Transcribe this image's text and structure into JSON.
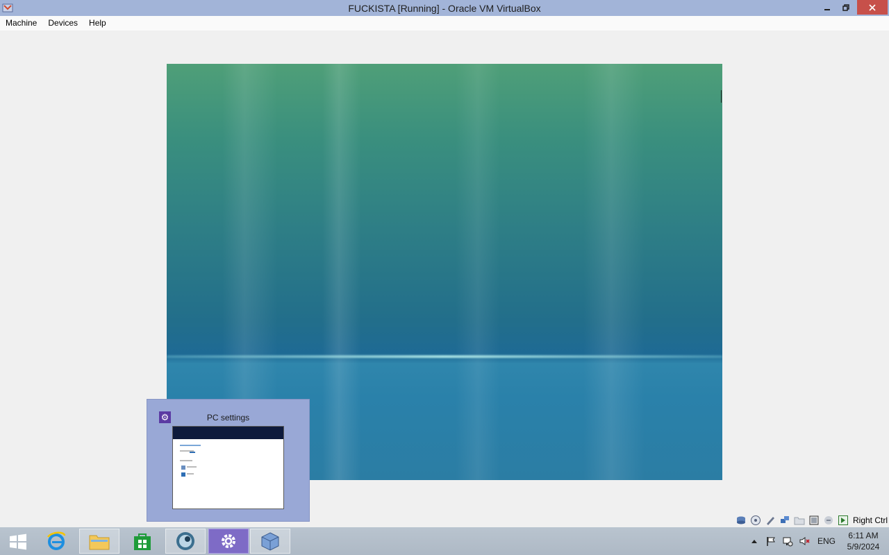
{
  "window": {
    "title": "FUCKISTA [Running] - Oracle VM VirtualBox",
    "icon": "virtualbox-icon",
    "controls": {
      "minimize": "minimize-icon",
      "restore": "restore-icon",
      "close": "close-icon"
    }
  },
  "menu": {
    "items": [
      {
        "label": "Machine"
      },
      {
        "label": "Devices"
      },
      {
        "label": "Help"
      }
    ]
  },
  "guest": {
    "wallpaper": "windows-vista-aurora",
    "colors": {
      "top": "#4f9f78",
      "bottom": "#2b7da4"
    }
  },
  "preview": {
    "title": "PC settings",
    "icon": "gear-icon"
  },
  "statusbar": {
    "icons": [
      "hard-disk-icon",
      "optical-drive-icon",
      "audio-icon",
      "network-icon",
      "shared-folders-icon",
      "display-icon",
      "usb-icon",
      "mouse-integration-icon"
    ],
    "host_key": "Right Ctrl"
  },
  "taskbar": {
    "apps": [
      {
        "name": "internet-explorer",
        "icon": "internet-explorer-icon",
        "state": "pinned"
      },
      {
        "name": "file-explorer",
        "icon": "folder-icon",
        "state": "pinned-running"
      },
      {
        "name": "store",
        "icon": "store-icon",
        "state": "pinned"
      },
      {
        "name": "media-app",
        "icon": "globe-icon",
        "state": "pinned-running"
      },
      {
        "name": "pc-settings",
        "icon": "gear-icon",
        "state": "active"
      },
      {
        "name": "virtualbox",
        "icon": "virtualbox-icon",
        "state": "pinned-running"
      }
    ],
    "tray": {
      "icons": [
        "show-hidden-icon",
        "action-center-flag-icon",
        "network-icon",
        "volume-muted-icon"
      ],
      "language": "ENG",
      "time": "6:11 AM",
      "date": "5/9/2024"
    }
  }
}
